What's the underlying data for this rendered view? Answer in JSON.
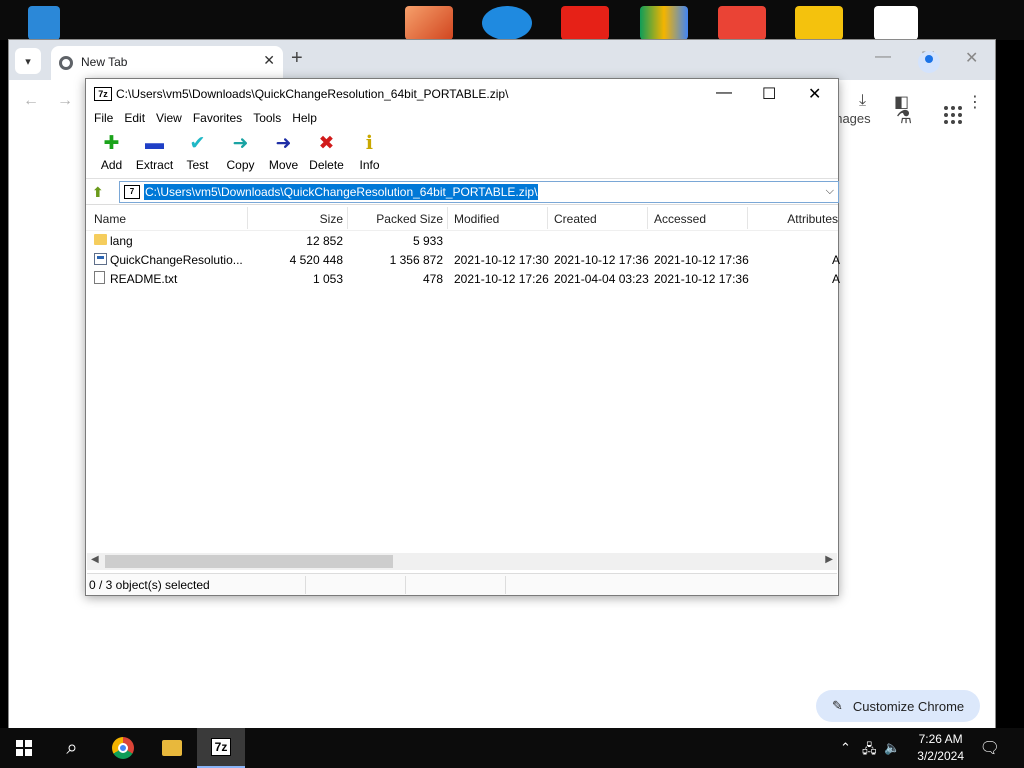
{
  "chrome": {
    "tab_title": "New Tab",
    "images_link": "Images",
    "customize_label": "Customize Chrome"
  },
  "zip": {
    "title": "C:\\Users\\vm5\\Downloads\\QuickChangeResolution_64bit_PORTABLE.zip\\",
    "logo": "7z",
    "menu": [
      "File",
      "Edit",
      "View",
      "Favorites",
      "Tools",
      "Help"
    ],
    "toolbar": [
      {
        "label": "Add",
        "icon": "plus-icon",
        "color": "#1aa31a"
      },
      {
        "label": "Extract",
        "icon": "minus-icon",
        "color": "#1f3fc6"
      },
      {
        "label": "Test",
        "icon": "check-icon",
        "color": "#1fb8c6"
      },
      {
        "label": "Copy",
        "icon": "arrow-right-icon",
        "color": "#1aa3a3"
      },
      {
        "label": "Move",
        "icon": "arrow-right-icon",
        "color": "#1f2fa6"
      },
      {
        "label": "Delete",
        "icon": "x-icon",
        "color": "#d11a1a"
      },
      {
        "label": "Info",
        "icon": "info-icon",
        "color": "#c9a800"
      }
    ],
    "address": "C:\\Users\\vm5\\Downloads\\QuickChangeResolution_64bit_PORTABLE.zip\\",
    "columns": [
      "Name",
      "Size",
      "Packed Size",
      "Modified",
      "Created",
      "Accessed",
      "Attributes"
    ],
    "rows": [
      {
        "name": "lang",
        "type": "folder",
        "size": "12 852",
        "packed": "5 933",
        "modified": "",
        "created": "",
        "accessed": "",
        "attr": ""
      },
      {
        "name": "QuickChangeResolutio...",
        "type": "exe",
        "size": "4 520 448",
        "packed": "1 356 872",
        "modified": "2021-10-12 17:30",
        "created": "2021-10-12 17:36",
        "accessed": "2021-10-12 17:36",
        "attr": "A"
      },
      {
        "name": "README.txt",
        "type": "txt",
        "size": "1 053",
        "packed": "478",
        "modified": "2021-10-12 17:26",
        "created": "2021-04-04 03:23",
        "accessed": "2021-10-12 17:36",
        "attr": "A"
      }
    ],
    "status": "0 / 3 object(s) selected"
  },
  "taskbar": {
    "zip_label": "7z",
    "time": "7:26 AM",
    "date": "3/2/2024"
  }
}
